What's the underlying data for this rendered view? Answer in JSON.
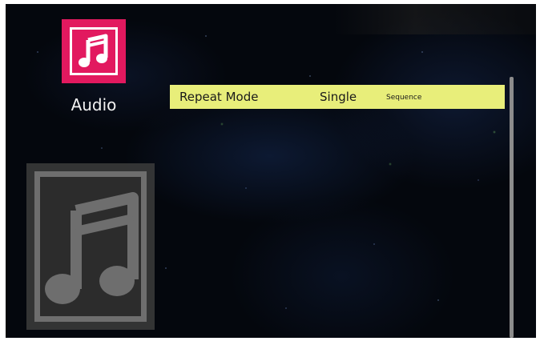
{
  "category": {
    "label": "Audio",
    "icon": "music-note-icon",
    "accent_color": "#e2195f"
  },
  "settings_list": [
    {
      "label": "Repeat Mode",
      "value": "Single",
      "option": "Sequence",
      "highlight_color": "#e8ee7a"
    }
  ],
  "preview": {
    "icon": "music-note-icon"
  }
}
